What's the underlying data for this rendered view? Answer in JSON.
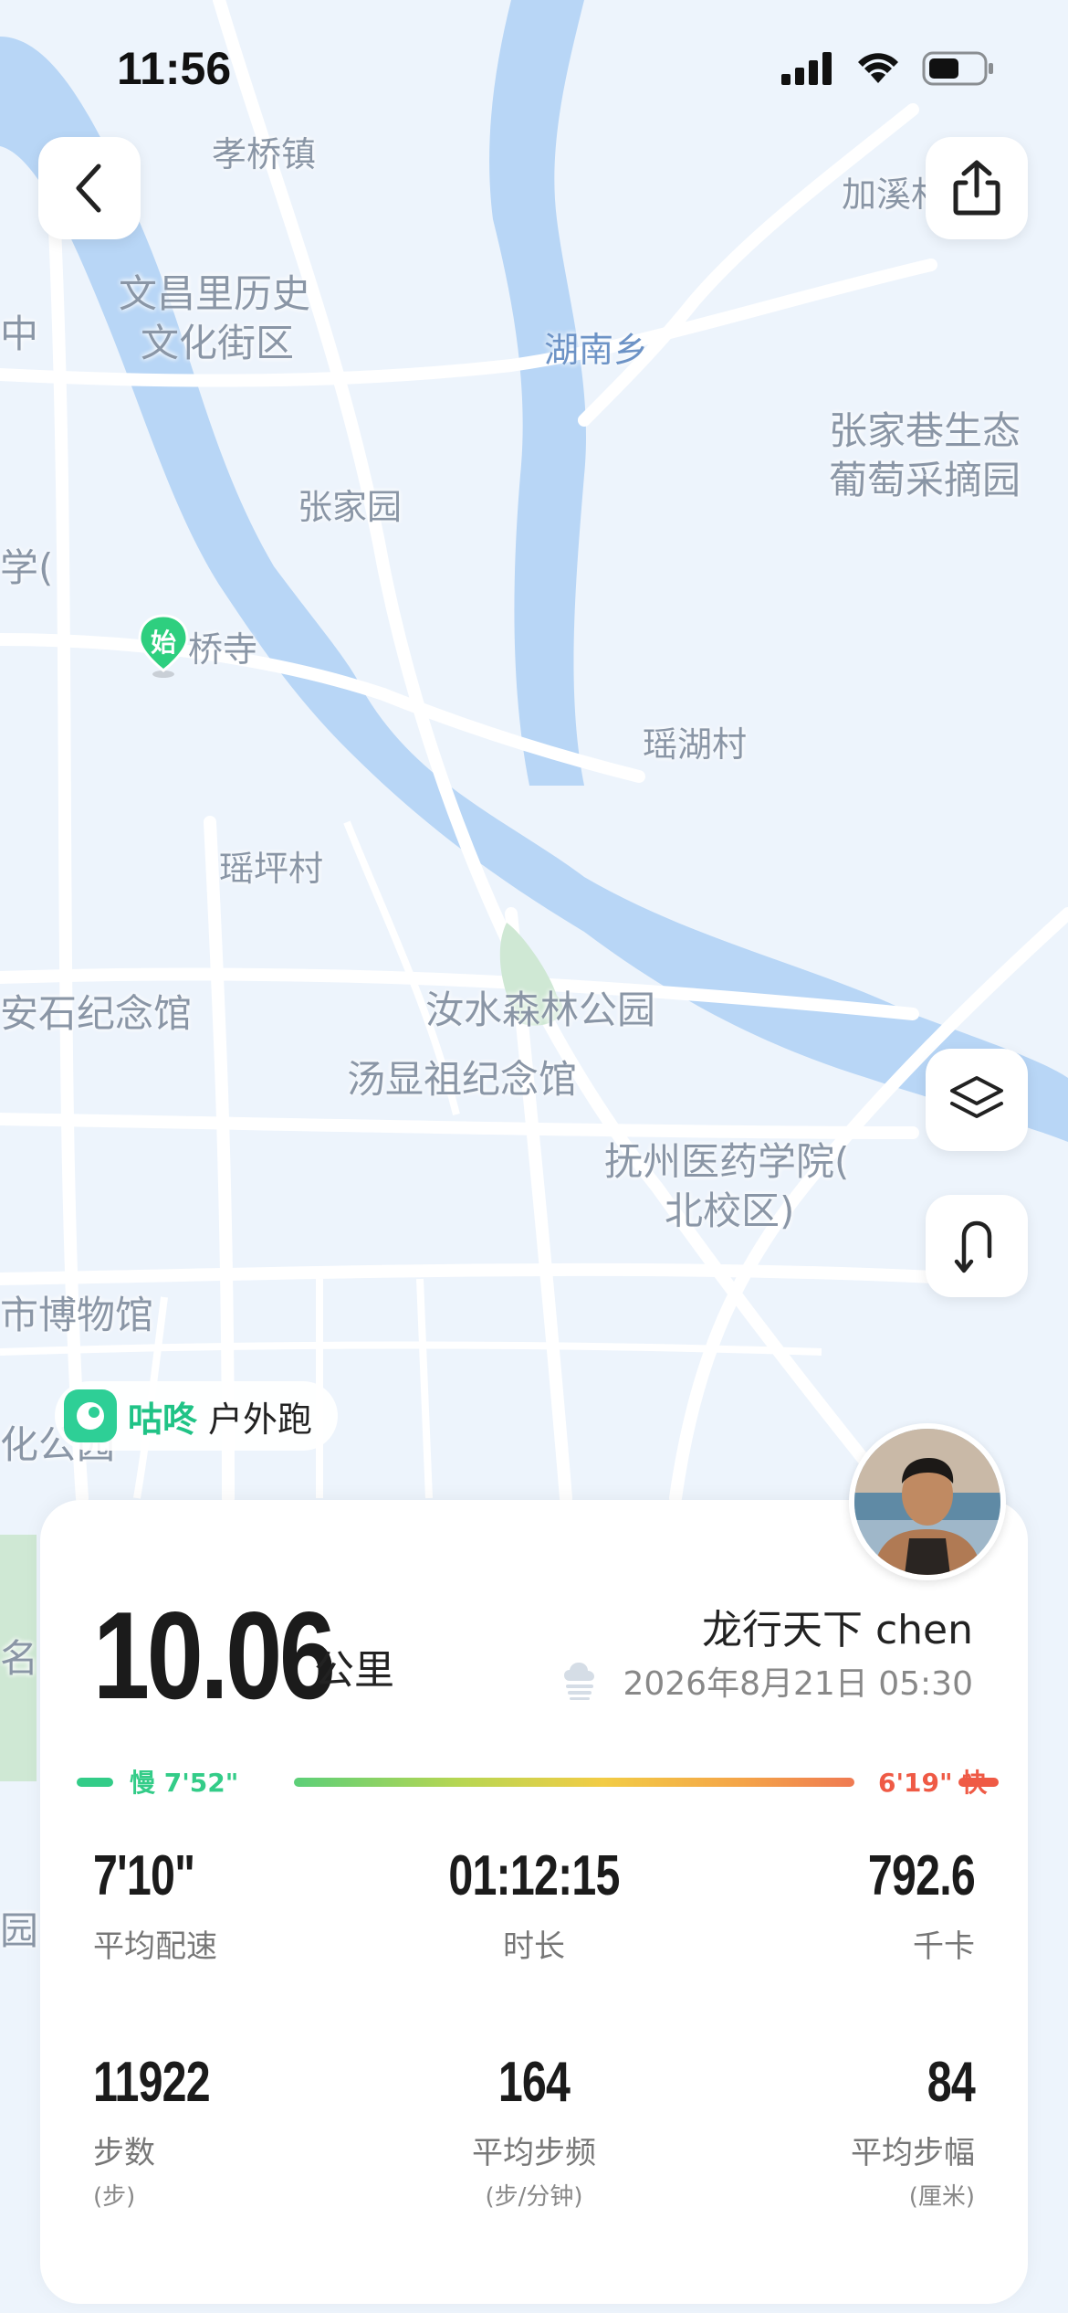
{
  "status_bar": {
    "time": "11:56"
  },
  "map": {
    "labels": [
      "孝桥镇",
      "加溪村",
      "文昌里历史",
      "文化街区",
      "湖南乡",
      "张家巷生态",
      "葡萄采摘园",
      "张家园",
      "桥寺",
      "瑶湖村",
      "瑶坪村",
      "安石纪念馆",
      "汝水森林公园",
      "汤显祖纪念馆",
      "抚州医药学院(",
      "北校区)",
      "市博物馆",
      "中",
      "学(",
      "名",
      "园",
      "化公园"
    ],
    "start_marker": "始"
  },
  "brand": {
    "name": "咕咚",
    "subtitle": "户外跑"
  },
  "summary": {
    "distance": "10.06",
    "distance_unit": "公里",
    "user_name": "龙行天下 chen",
    "date": "2026年8月21日 05:30",
    "weather_icon": "cloud-icon"
  },
  "pace_bar": {
    "slow_label": "慢 7'52\"",
    "fast_label": "6'19\" 快",
    "slow_color": "#33cc88",
    "fast_color": "#ef5a45"
  },
  "stats": [
    {
      "value": "7'10\"",
      "label": "平均配速",
      "sub": ""
    },
    {
      "value": "01:12:15",
      "label": "时长",
      "sub": ""
    },
    {
      "value": "792.6",
      "label": "千卡",
      "sub": ""
    },
    {
      "value": "11922",
      "label": "步数",
      "sub": "(步)"
    },
    {
      "value": "164",
      "label": "平均步频",
      "sub": "(步/分钟)"
    },
    {
      "value": "84",
      "label": "平均步幅",
      "sub": "(厘米)"
    }
  ],
  "icons": {
    "back": "chevron-left-icon",
    "share": "share-icon",
    "layers": "layers-icon",
    "route": "route-toggle-icon"
  }
}
